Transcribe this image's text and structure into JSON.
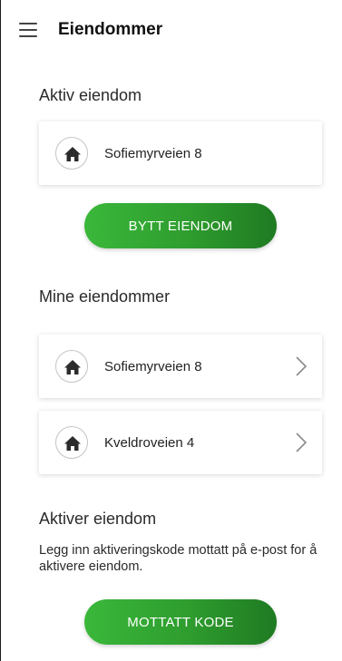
{
  "header": {
    "title": "Eiendommer",
    "menu_icon": "hamburger-menu-icon"
  },
  "active": {
    "section_title": "Aktiv eiendom",
    "property": "Sofiemyrveien 8",
    "button_label": "BYTT EIENDOM"
  },
  "mine": {
    "section_title": "Mine eiendommer",
    "items": [
      {
        "label": "Sofiemyrveien 8"
      },
      {
        "label": "Kveldroveien 4"
      }
    ]
  },
  "activate": {
    "section_title": "Aktiver eiendom",
    "description": "Legg inn aktiveringskode mottatt på e-post for å aktivere eiendom.",
    "button_label": "MOTTATT KODE"
  },
  "colors": {
    "accent_green": "#2e9c2e",
    "accent_green_dark": "#1f7a22"
  },
  "icons": {
    "property": "house-icon",
    "navigate": "chevron-right-icon"
  }
}
